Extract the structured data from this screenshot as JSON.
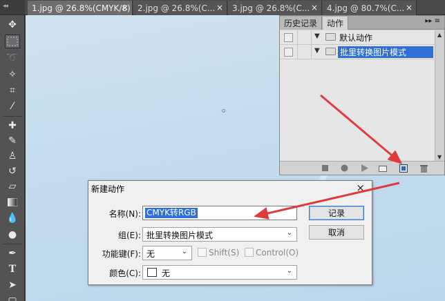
{
  "tabs": [
    {
      "label": "1.jpg @ 26.8%(CMYK/8)",
      "close": "×"
    },
    {
      "label": "2.jpg @ 26.8%(C...",
      "close": "×"
    },
    {
      "label": "3.jpg @ 26.8%(C...",
      "close": "×"
    },
    {
      "label": "4.jpg @ 80.7%(C...",
      "close": "×"
    }
  ],
  "actions_panel": {
    "tab_history": "历史记录",
    "tab_actions": "动作",
    "menu": "▸▸ ≡",
    "rows": [
      {
        "label": "默认动作"
      },
      {
        "label": "批里转换图片模式"
      }
    ],
    "footer_icons": [
      "stop-icon",
      "record-icon",
      "play-icon",
      "new-set-icon",
      "new-action-icon",
      "trash-icon"
    ]
  },
  "dialog": {
    "title": "新建动作",
    "close": "×",
    "name_label": "名称(N):",
    "name_value": "CMYK转RGB",
    "group_label": "组(E):",
    "group_value": "批里转换图片模式",
    "fkey_label": "功能键(F):",
    "fkey_value": "无",
    "shift_label": "Shift(S)",
    "control_label": "Control(O)",
    "color_label": "颜色(C):",
    "color_value": "无",
    "record_button": "记录",
    "cancel_button": "取消"
  },
  "colors": {
    "accent": "#2f6fd6",
    "arrow": "#e23a3a"
  }
}
